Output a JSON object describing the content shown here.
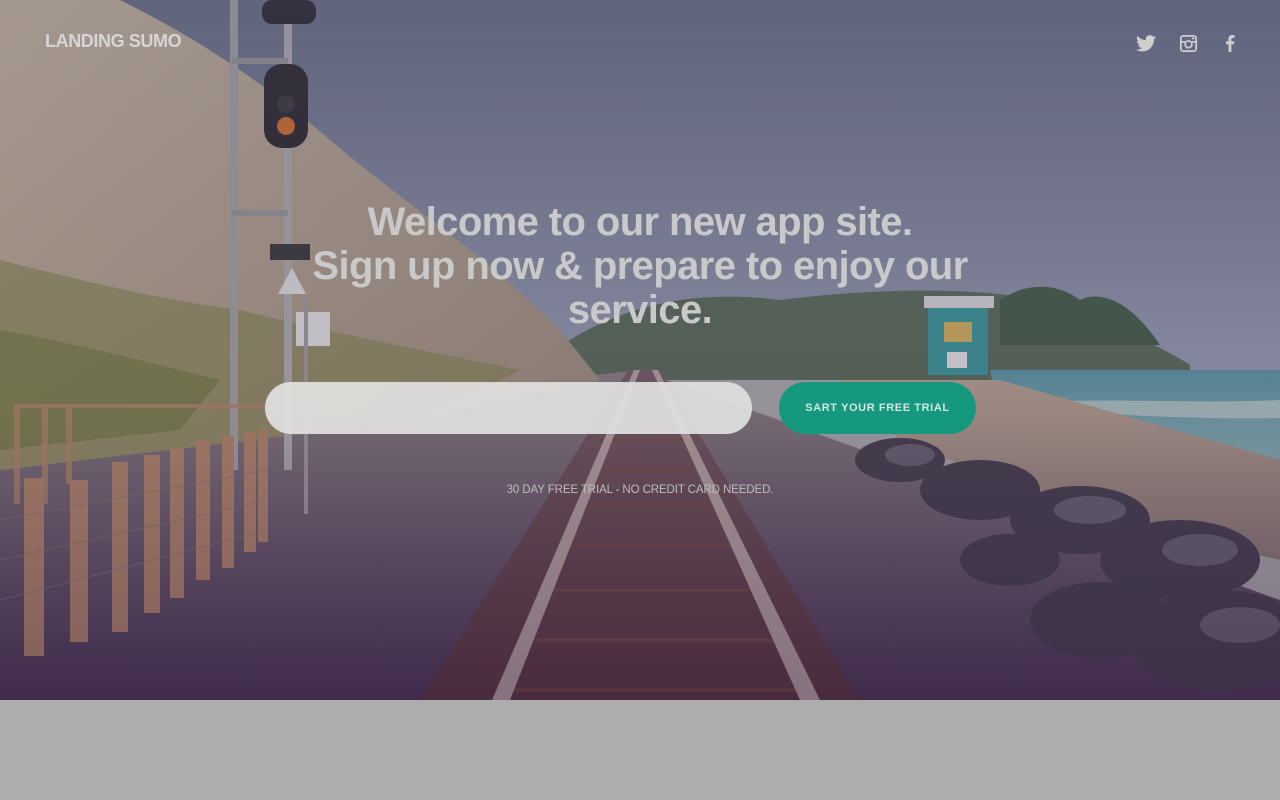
{
  "brand": {
    "logo_text": "LANDING SUMO"
  },
  "social": [
    {
      "name": "twitter",
      "icon": "twitter-icon"
    },
    {
      "name": "instagram",
      "icon": "instagram-icon"
    },
    {
      "name": "facebook",
      "icon": "facebook-icon"
    }
  ],
  "hero": {
    "headline_line1": "Welcome to our new app site.",
    "headline_line2": "Sign up now & prepare to enjoy our",
    "headline_line3": "service.",
    "email_placeholder": "",
    "email_value": "",
    "cta_label": "SART YOUR FREE TRIAL",
    "trial_note": "30 DAY FREE TRIAL - NO CREDIT CARD NEEDED."
  },
  "colors": {
    "accent": "#16987e",
    "logo": "#d6d6d6",
    "headline": "#c9c9c9",
    "page_background": "#adadad"
  }
}
